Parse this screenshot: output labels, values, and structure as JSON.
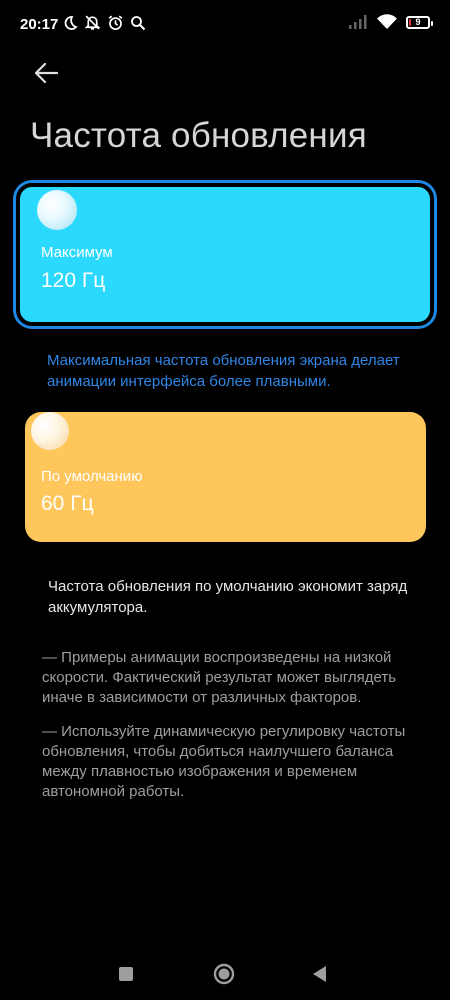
{
  "status_bar": {
    "time": "20:17",
    "battery": "9",
    "battery_level": 0.09,
    "icons_left": [
      "moon-icon",
      "bell-off-icon",
      "alarm-icon",
      "search-icon"
    ],
    "icons_right": [
      "signal-icon",
      "wifi-icon",
      "battery-icon"
    ]
  },
  "header": {
    "back_icon": "arrow-left-icon",
    "title": "Частота обновления"
  },
  "options": {
    "max": {
      "label": "Максимум",
      "value": "120 Гц",
      "selected": true,
      "color": "#2bd9ff",
      "description": "Максимальная частота обновления экрана делает анимации интерфейса более плавными."
    },
    "default": {
      "label": "По умолчанию",
      "value": "60 Гц",
      "selected": false,
      "color": "#ffc65c",
      "description": "Частота обновления по умолчанию экономит заряд аккумулятора."
    }
  },
  "notes": [
    "— Примеры анимации воспроизведены на низкой скорости. Фактический результат может выглядеть иначе в зависимости от различных факторов.",
    "— Используйте динамическую регулировку частоты обновления, чтобы добиться наилучшего баланса между плавностью изображения и временем автономной работы."
  ],
  "colors": {
    "accent": "#1e88e5",
    "description_blue": "#2f86e6",
    "background": "#000000"
  },
  "nav_bar": {
    "buttons": [
      "recents-icon",
      "home-icon",
      "back-icon"
    ]
  }
}
